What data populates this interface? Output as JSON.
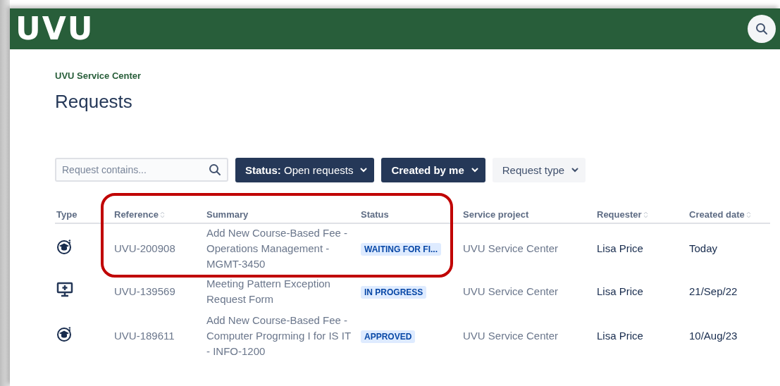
{
  "header": {
    "logo": "UVU"
  },
  "breadcrumb": "UVU Service Center",
  "title": "Requests",
  "search": {
    "placeholder": "Request contains..."
  },
  "filters": [
    {
      "label": "**Status:** Open requests",
      "active": true
    },
    {
      "label": "Created by me",
      "active": true
    },
    {
      "label": "Request type",
      "active": false
    }
  ],
  "table": {
    "columns": [
      {
        "label": "Type",
        "sortable": false
      },
      {
        "label": "Reference",
        "sortable": true
      },
      {
        "label": "Summary",
        "sortable": false
      },
      {
        "label": "Status",
        "sortable": false
      },
      {
        "label": "Service project",
        "sortable": false
      },
      {
        "label": "Requester",
        "sortable": true
      },
      {
        "label": "Created date",
        "sortable": true
      }
    ],
    "rows": [
      {
        "kind": "fee",
        "reference": "UVU-200908",
        "summary": "Add New Course-Based Fee - Operations Management - MGMT-3450",
        "status": "WAITING FOR FI...",
        "project": "UVU Service Center",
        "requester": "Lisa Price",
        "created": "Today",
        "highlighted": true
      },
      {
        "kind": "meeting",
        "reference": "UVU-139569",
        "summary": "Meeting Pattern Exception Request Form",
        "status": "IN PROGRESS",
        "project": "UVU Service Center",
        "requester": "Lisa Price",
        "created": "21/Sep/22",
        "highlighted": false
      },
      {
        "kind": "fee",
        "reference": "UVU-189611",
        "summary": "Add New Course-Based Fee - Computer Progrming I for IS IT - INFO-1200",
        "status": "APPROVED",
        "project": "UVU Service Center",
        "requester": "Lisa Price",
        "created": "10/Aug/23",
        "highlighted": false
      }
    ]
  }
}
